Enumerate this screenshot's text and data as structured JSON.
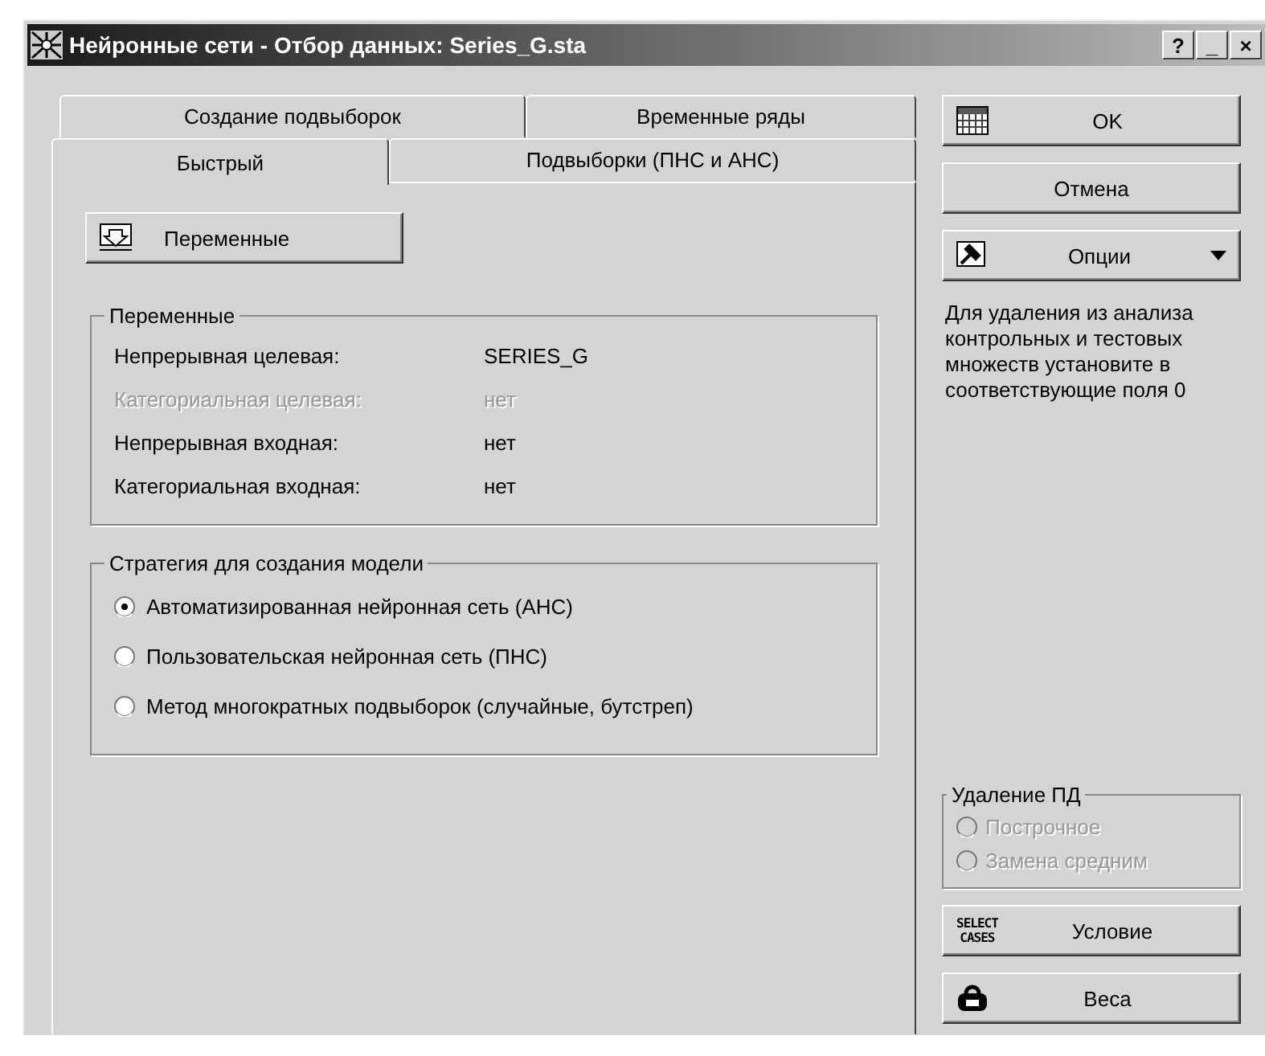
{
  "window": {
    "title": "Нейронные сети - Отбор данных: Series_G.sta",
    "controls": [
      "?",
      "_",
      "×"
    ]
  },
  "tab_rows": [
    [
      {
        "label": "Создание подвыборок",
        "selected": false
      },
      {
        "label": "Временные ряды",
        "selected": false
      }
    ],
    [
      {
        "label": "Быстрый",
        "selected": true
      },
      {
        "label": "Подвыборки (ПНС и АНС)",
        "selected": false
      }
    ]
  ],
  "variables_button": {
    "label": "Переменные"
  },
  "variables_group": {
    "title": "Переменные",
    "rows": [
      {
        "label": "Непрерывная целевая:",
        "value": "SERIES_G",
        "disabled": false
      },
      {
        "label": "Категориальная целевая:",
        "value": "нет",
        "disabled": true
      },
      {
        "label": "Непрерывная входная:",
        "value": "нет",
        "disabled": false
      },
      {
        "label": "Категориальная входная:",
        "value": "нет",
        "disabled": false
      }
    ]
  },
  "strategy_group": {
    "title": "Стратегия для создания модели",
    "options": [
      {
        "label": "Автоматизированная нейронная сеть (АНС)",
        "selected": true,
        "disabled": false
      },
      {
        "label": "Пользовательская нейронная сеть (ПНС)",
        "selected": false,
        "disabled": false
      },
      {
        "label": "Метод многократных подвыборок (случайные, бутстреп)",
        "selected": false,
        "disabled": false
      }
    ]
  },
  "side_buttons": [
    {
      "kind": "table",
      "label": "OK"
    },
    {
      "kind": "plain",
      "label": "Отмена"
    },
    {
      "kind": "options",
      "label": "Опции"
    }
  ],
  "note": "Для удаления из анализа контрольных и тестовых множеств установите в соответствующие поля 0",
  "md_group": {
    "title": "Удаление ПД",
    "options": [
      {
        "label": "Построчное",
        "selected": false,
        "disabled": true
      },
      {
        "label": "Замена средним",
        "selected": false,
        "disabled": true
      }
    ]
  },
  "bottom_buttons": [
    {
      "kind": "select_cases",
      "icon_text": [
        "SELECT",
        "CASES"
      ],
      "label": "Условие"
    },
    {
      "kind": "weights",
      "label": "Веса"
    }
  ]
}
